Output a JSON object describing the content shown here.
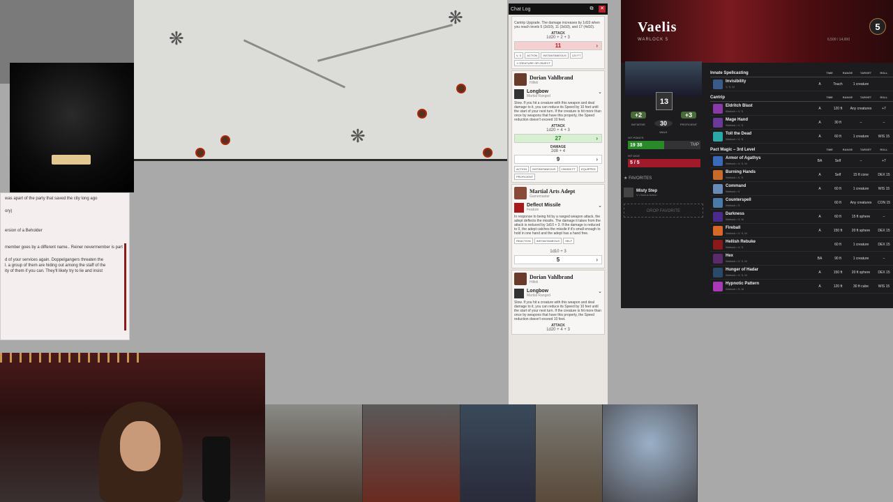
{
  "map": {
    "label": "Battle map"
  },
  "notes": {
    "lines": [
      "was apart of the party that saved the city long ago",
      "ory)",
      "ersion of a Beholder",
      "member goes by a different name.. Reiner nevermember is part",
      "d of your services again. Doppelgangers threaten the",
      "l. a group of them are hiding out among the staff of the",
      "ity of them if you can. They'll likely try to lie and insist"
    ]
  },
  "chat": {
    "title": "Chat Log",
    "top_card": {
      "desc": "Cantrip Upgrade. The damage increases by 1d10 when you reach levels 5 (2d10), 11 (3d10), and 17 (4d10).",
      "attack_label": "ATTACK",
      "roll": "1d20 + 2 + 3",
      "result": "11",
      "tags": [
        "V, S",
        "ACTION",
        "INSTANTANEOUS",
        "120 FT",
        "1 CREATURE OR OBJECT"
      ]
    },
    "card1": {
      "name": "Dorian Vahlbrand",
      "sub": "Hilfeli",
      "weapon": "Longbow",
      "weapon_sub": "Martial Ranged",
      "desc": "Slow. If you hit a creature with this weapon and deal damage to it, you can reduce its Speed by 10 feet until the start of your next turn. If the creature is hit more than once by weapons that have this property, the Speed reduction doesn't exceed 10 feet.",
      "attack_label": "ATTACK",
      "roll": "1d20 + 4 + 3",
      "result": "27",
      "damage_label": "DAMAGE",
      "dmg_roll": "2d8 + 4",
      "dmg_result": "9",
      "tags": [
        "ACTION",
        "INSTANTANEOUS",
        "150/600 FT",
        "EQUIPPED",
        "PROFICIENT"
      ]
    },
    "card2": {
      "name": "Martial Arts Adept",
      "sub": "Gamemaster",
      "weapon": "Deflect Missile",
      "weapon_sub": "Feature",
      "desc": "In response to being hit by a ranged weapon attack, the adept deflects the missile. The damage it takes from the attack is reduced by 1d10 + 3. If the damage is reduced to 0, the adept catches the missile if it's small enough to hold in one hand and the adept has a hand free.",
      "tags": [
        "REACTION",
        "INSTANTANEOUS",
        "SELF"
      ],
      "roll": "1d10 + 3",
      "result": "5"
    },
    "card3": {
      "name": "Dorian Vahlbrand",
      "sub": "Hilfeli",
      "weapon": "Longbow",
      "weapon_sub": "Martial Ranged",
      "desc": "Slow. If you hit a creature with this weapon and deal damage to it, you can reduce its Speed by 10 feet until the start of your next turn. If the creature is hit more than once by weapons that have this property, the Speed reduction doesn't exceed 10 feet.",
      "attack_label": "ATTACK",
      "roll": "1d20 + 4 + 3"
    }
  },
  "sheet": {
    "name": "Vaelis",
    "class": "WARLOCK 5",
    "level": "5",
    "xp": "6,500 / 14,000",
    "ac": "13",
    "initiative": "+2",
    "initiative_label": "INITIATIVE",
    "walk": "30",
    "walk_label": "WALK",
    "proficiency": "+3",
    "proficiency_label": "PROFICIENT",
    "hp_label": "HIT POINTS",
    "hp": "19",
    "hp_max": "38",
    "hp_fraction": 0.5,
    "tmp": "TMP",
    "hd_label": "HIT DICE",
    "hit_dice": "5 / 5",
    "favorites_label": "FAVORITES",
    "favorite": {
      "name": "Misty Step",
      "sub": "V • Bonus Action"
    },
    "drop": "DROP FAVORITE",
    "columns": [
      "TIME",
      "RANGE",
      "TARGET",
      "ROLL"
    ],
    "sections": [
      {
        "title": "Innate Spellcasting",
        "spells": [
          {
            "name": "Invisibility",
            "sub": "V, S, M",
            "time": "A",
            "range": "Touch",
            "target": "1 creature",
            "roll": "",
            "color": "#3a5a8a"
          }
        ]
      },
      {
        "title": "Cantrip",
        "spells": [
          {
            "name": "Eldritch Blast",
            "sub": "Warlock • V, S",
            "time": "A",
            "range": "120 ft",
            "target": "Any creatures",
            "roll": "+7",
            "color": "#8a3aa8"
          },
          {
            "name": "Mage Hand",
            "sub": "Warlock • V, S",
            "time": "A",
            "range": "30 ft",
            "target": "–",
            "roll": "–",
            "color": "#6a3a9a"
          },
          {
            "name": "Toll the Dead",
            "sub": "Warlock • V, S",
            "time": "A",
            "range": "60 ft",
            "target": "1 creature",
            "roll": "WIS 15",
            "color": "#2aa8a8"
          }
        ]
      },
      {
        "title": "Pact Magic – 3rd Level",
        "spells": [
          {
            "name": "Armor of Agathys",
            "sub": "Warlock • V, S, M",
            "time": "BA",
            "range": "Self",
            "target": "–",
            "roll": "+7",
            "color": "#3a6ab8"
          },
          {
            "name": "Burning Hands",
            "sub": "Warlock • V, S",
            "time": "A",
            "range": "Self",
            "target": "15 ft cone",
            "roll": "DEX 15",
            "color": "#c86a2a"
          },
          {
            "name": "Command",
            "sub": "Warlock • V",
            "time": "A",
            "range": "60 ft",
            "target": "1 creature",
            "roll": "WIS 15",
            "color": "#6a8ab8"
          },
          {
            "name": "Counterspell",
            "sub": "Warlock • S",
            "time": "",
            "range": "60 ft",
            "target": "Any creatures",
            "roll": "CON 15",
            "color": "#4a7aa8"
          },
          {
            "name": "Darkness",
            "sub": "Warlock • V, M",
            "time": "A",
            "range": "60 ft",
            "target": "15 ft sphere",
            "roll": "–",
            "color": "#4a2a8a"
          },
          {
            "name": "Fireball",
            "sub": "Warlock • V, S, M",
            "time": "A",
            "range": "150 ft",
            "target": "20 ft sphere",
            "roll": "DEX 15",
            "color": "#d8682a"
          },
          {
            "name": "Hellish Rebuke",
            "sub": "Warlock • V, S",
            "time": "",
            "range": "60 ft",
            "target": "1 creature",
            "roll": "DEX 15",
            "color": "#8a1a1a"
          },
          {
            "name": "Hex",
            "sub": "Warlock • V, S, M",
            "time": "BA",
            "range": "90 ft",
            "target": "1 creature",
            "roll": "–",
            "color": "#5a2a6a"
          },
          {
            "name": "Hunger of Hadar",
            "sub": "Warlock • V, S, M",
            "time": "A",
            "range": "150 ft",
            "target": "20 ft sphere",
            "roll": "DEX 15",
            "color": "#2a4a6a"
          },
          {
            "name": "Hypnotic Pattern",
            "sub": "Warlock • S, M",
            "time": "A",
            "range": "120 ft",
            "target": "30 ft cube",
            "roll": "WIS 15",
            "color": "#a83ab8"
          }
        ]
      }
    ]
  }
}
